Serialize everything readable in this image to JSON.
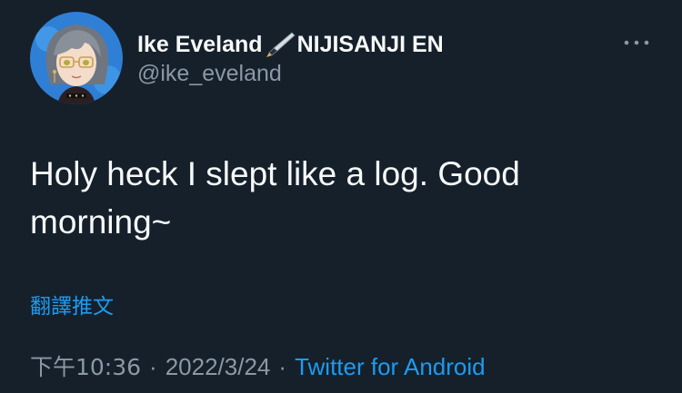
{
  "author": {
    "display_name": "Ike Eveland",
    "affiliation": "NIJISANJI EN",
    "handle": "@ike_eveland",
    "avatar_icon": "user-avatar",
    "badge_icon": "fountain-pen-icon"
  },
  "more_icon": "more-horizontal-icon",
  "tweet": {
    "text": "Holy heck I slept like a log. Good morning~",
    "translate_label": "翻譯推文"
  },
  "meta": {
    "time": "下午10:36",
    "date": "2022/3/24",
    "separator": "·",
    "source": "Twitter for Android"
  },
  "colors": {
    "background": "#15202b",
    "primary_text": "#f7f9f9",
    "secondary_text": "#8b98a5",
    "accent": "#1d9bf0"
  }
}
